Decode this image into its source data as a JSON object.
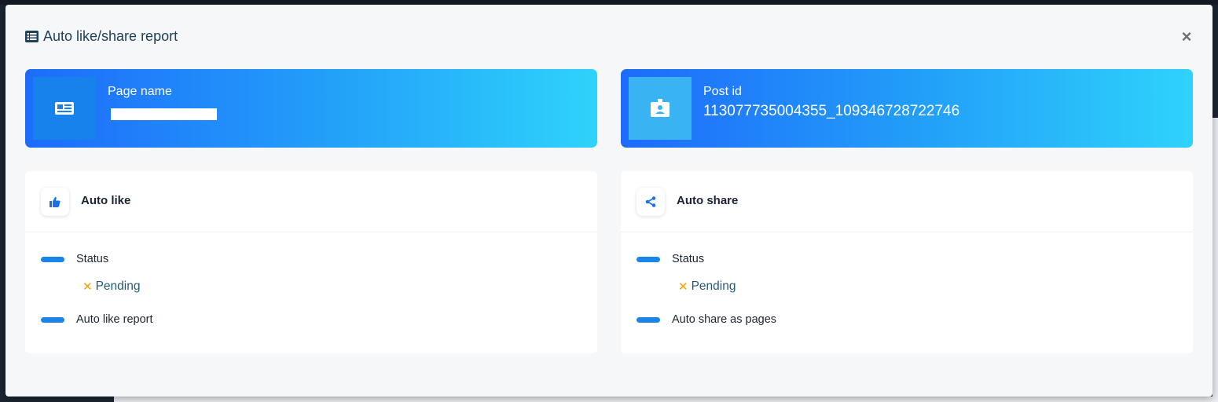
{
  "modal": {
    "title": "Auto like/share report",
    "close_label": "×"
  },
  "info_cards": {
    "page": {
      "label": "Page name",
      "value": "",
      "icon": "newspaper-icon"
    },
    "post": {
      "label": "Post id",
      "value": "113077735004355_109346728722746",
      "icon": "id-badge-icon"
    }
  },
  "panels": {
    "like": {
      "title": "Auto like",
      "icon": "thumbs-up-icon",
      "status_label": "Status",
      "status_value": "Pending",
      "status_icon": "x-icon",
      "report_label": "Auto like report"
    },
    "share": {
      "title": "Auto share",
      "icon": "share-icon",
      "status_label": "Status",
      "status_value": "Pending",
      "status_icon": "x-icon",
      "report_label": "Auto share as pages"
    }
  },
  "colors": {
    "gradient_start": "#1e6bfb",
    "gradient_end": "#2ed3fb",
    "accent_blue": "#1b84e8",
    "pending_orange": "#f5a20a",
    "title_color": "#1f4157"
  }
}
